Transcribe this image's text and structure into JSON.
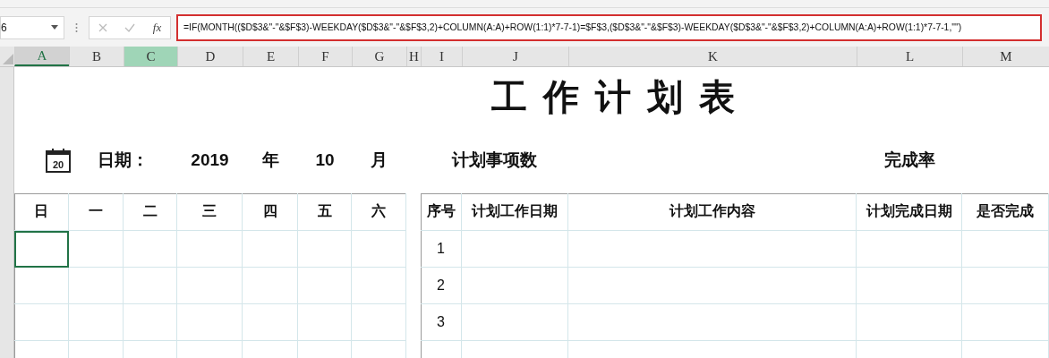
{
  "name_box": {
    "value": "6"
  },
  "formula_bar": {
    "function_label": "fx",
    "formula": "=IF(MONTH(($D$3&\"-\"&$F$3)-WEEKDAY($D$3&\"-\"&$F$3,2)+COLUMN(A:A)+ROW(1:1)*7-7-1)=$F$3,($D$3&\"-\"&$F$3)-WEEKDAY($D$3&\"-\"&$F$3,2)+COLUMN(A:A)+ROW(1:1)*7-7-1,\"\")"
  },
  "columns": [
    {
      "label": "A",
      "selected": true,
      "highlighted": false
    },
    {
      "label": "B",
      "selected": false,
      "highlighted": false
    },
    {
      "label": "C",
      "selected": false,
      "highlighted": true
    },
    {
      "label": "D",
      "selected": false,
      "highlighted": false
    },
    {
      "label": "E",
      "selected": false,
      "highlighted": false
    },
    {
      "label": "F",
      "selected": false,
      "highlighted": false
    },
    {
      "label": "G",
      "selected": false,
      "highlighted": false
    },
    {
      "label": "H",
      "selected": false,
      "highlighted": false
    },
    {
      "label": "I",
      "selected": false,
      "highlighted": false
    },
    {
      "label": "J",
      "selected": false,
      "highlighted": false
    },
    {
      "label": "K",
      "selected": false,
      "highlighted": false
    },
    {
      "label": "L",
      "selected": false,
      "highlighted": false
    },
    {
      "label": "M",
      "selected": false,
      "highlighted": false
    }
  ],
  "title": "工作计划表",
  "date_row": {
    "label": "日期：",
    "year": "2019",
    "year_unit": "年",
    "month": "10",
    "month_unit": "月",
    "plan_count_label": "计划事项数",
    "completion_rate_label": "完成率"
  },
  "calendar": {
    "weekdays": [
      "日",
      "一",
      "二",
      "三",
      "四",
      "五",
      "六"
    ],
    "rows": [
      [
        {
          "selected": true
        },
        {
          "selected": false
        },
        {
          "selected": false
        },
        {
          "selected": false
        },
        {
          "selected": false
        },
        {
          "selected": false
        },
        {
          "selected": false
        }
      ],
      [
        {
          "selected": false
        },
        {
          "selected": false
        },
        {
          "selected": false
        },
        {
          "selected": false
        },
        {
          "selected": false
        },
        {
          "selected": false
        },
        {
          "selected": false
        }
      ],
      [
        {
          "selected": false
        },
        {
          "selected": false
        },
        {
          "selected": false
        },
        {
          "selected": false
        },
        {
          "selected": false
        },
        {
          "selected": false
        },
        {
          "selected": false
        }
      ],
      [
        {
          "selected": false
        },
        {
          "selected": false
        },
        {
          "selected": false
        },
        {
          "selected": false
        },
        {
          "selected": false
        },
        {
          "selected": false
        },
        {
          "selected": false
        }
      ]
    ]
  },
  "plan_table": {
    "columns": [
      "序号",
      "计划工作日期",
      "计划工作内容",
      "计划完成日期",
      "是否完成"
    ],
    "rows": [
      "1",
      "2",
      "3"
    ]
  },
  "calendar_icon": {
    "day": "20"
  }
}
